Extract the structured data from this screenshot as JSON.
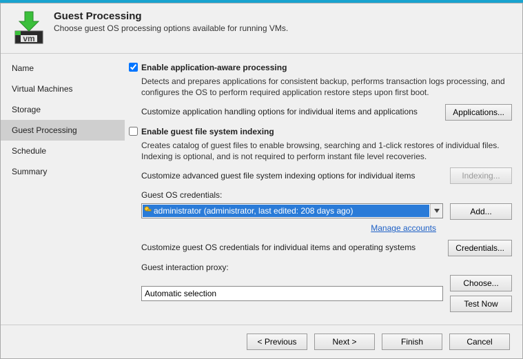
{
  "header": {
    "title": "Guest Processing",
    "subtitle": "Choose guest OS processing options available for running VMs."
  },
  "sidebar": [
    {
      "label": "Name"
    },
    {
      "label": "Virtual Machines"
    },
    {
      "label": "Storage"
    },
    {
      "label": "Guest Processing"
    },
    {
      "label": "Schedule"
    },
    {
      "label": "Summary"
    }
  ],
  "app_aware": {
    "title": "Enable application-aware processing",
    "desc": "Detects and prepares applications for consistent backup, performs transaction logs processing, and configures the OS to perform required application restore steps upon first boot.",
    "customize": "Customize application handling options for individual items and applications",
    "btn": "Applications..."
  },
  "indexing": {
    "title": "Enable guest file system indexing",
    "desc": "Creates catalog of guest files to enable browsing, searching and 1-click restores of individual files. Indexing is optional, and is not required to perform instant file level recoveries.",
    "customize": "Customize advanced guest file system indexing options for individual items",
    "btn": "Indexing..."
  },
  "creds": {
    "label": "Guest OS credentials:",
    "selected": "administrator (administrator, last edited: 208 days ago)",
    "add": "Add...",
    "manage": "Manage accounts",
    "customize": "Customize guest OS credentials for individual items and operating systems",
    "creds_btn": "Credentials..."
  },
  "proxy": {
    "label": "Guest interaction proxy:",
    "value": "Automatic selection",
    "choose": "Choose...",
    "test": "Test Now"
  },
  "footer": {
    "prev": "< Previous",
    "next": "Next >",
    "finish": "Finish",
    "cancel": "Cancel"
  }
}
